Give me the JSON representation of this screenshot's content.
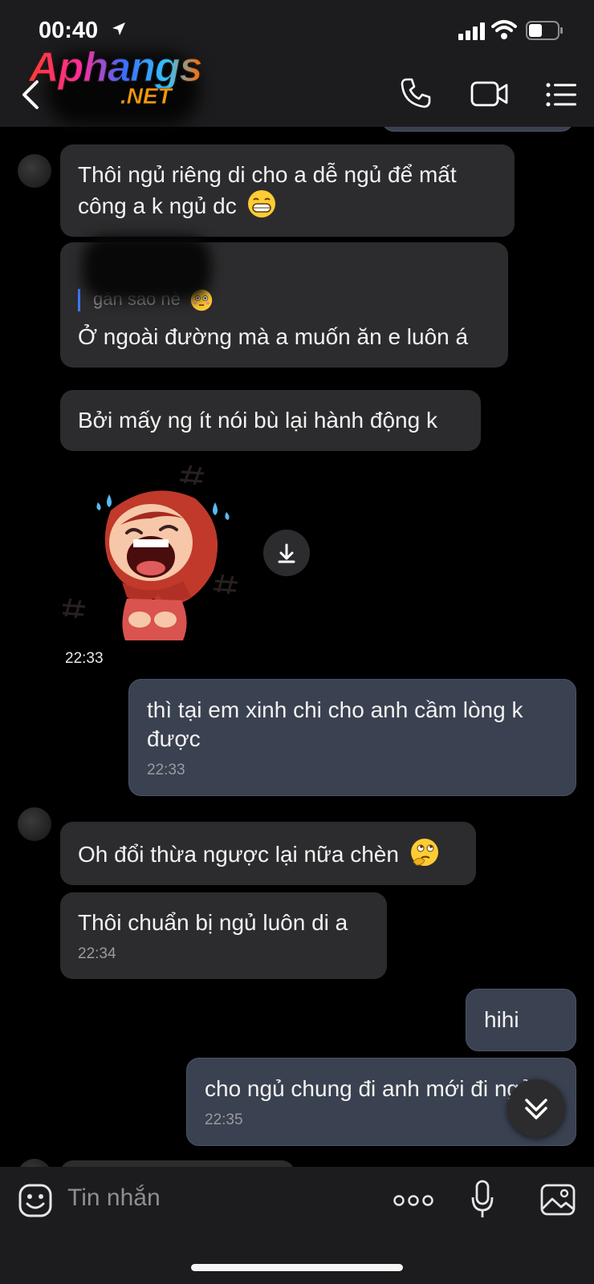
{
  "status_bar": {
    "time": "00:40"
  },
  "logo": {
    "main": "Aphangs",
    "sub": ".NET"
  },
  "header": {
    "back_icon": "chevron-left-icon",
    "call_icon": "phone-icon",
    "video_icon": "video-camera-icon",
    "menu_icon": "list-menu-icon"
  },
  "messages": [
    {
      "dir": "in",
      "text": "Thôi ngủ riêng di cho a dễ ngủ để mất công a k ngủ dc",
      "emoji": "grinning-face-emoji"
    },
    {
      "dir": "in",
      "quote": "gần sao nè",
      "quote_emoji": "flushed-face-emoji",
      "text": "Ở ngoài đường mà a muốn ăn e luôn á"
    },
    {
      "dir": "in",
      "text": "Bởi mấy ng ít nói bù lại hành động k"
    },
    {
      "dir": "in",
      "type": "sticker",
      "sticker": "laughing-red-hood-girl-sticker",
      "time": "22:33"
    },
    {
      "dir": "out",
      "text": "thì tại em xinh chi cho anh cầm lòng k được",
      "time": "22:33"
    },
    {
      "dir": "in",
      "text": "Oh đổi thừa ngược lại nữa chèn",
      "emoji": "thinking-face-emoji"
    },
    {
      "dir": "in",
      "text": "Thôi chuẩn bị ngủ luôn di a",
      "time": "22:34"
    },
    {
      "dir": "out",
      "text": "hihi"
    },
    {
      "dir": "out",
      "text": "cho ngủ chung đi anh mới đi ngủ",
      "time": "22:35"
    }
  ],
  "input": {
    "placeholder": "Tin nhắn",
    "emoji_icon": "emoji-icon",
    "more_icon": "more-dots-icon",
    "mic_icon": "microphone-icon",
    "image_icon": "image-icon"
  },
  "colors": {
    "header_bg": "#1c1c1e",
    "incoming_bubble": "#2c2c2e",
    "outgoing_bubble": "#3a4150",
    "background": "#000000"
  }
}
